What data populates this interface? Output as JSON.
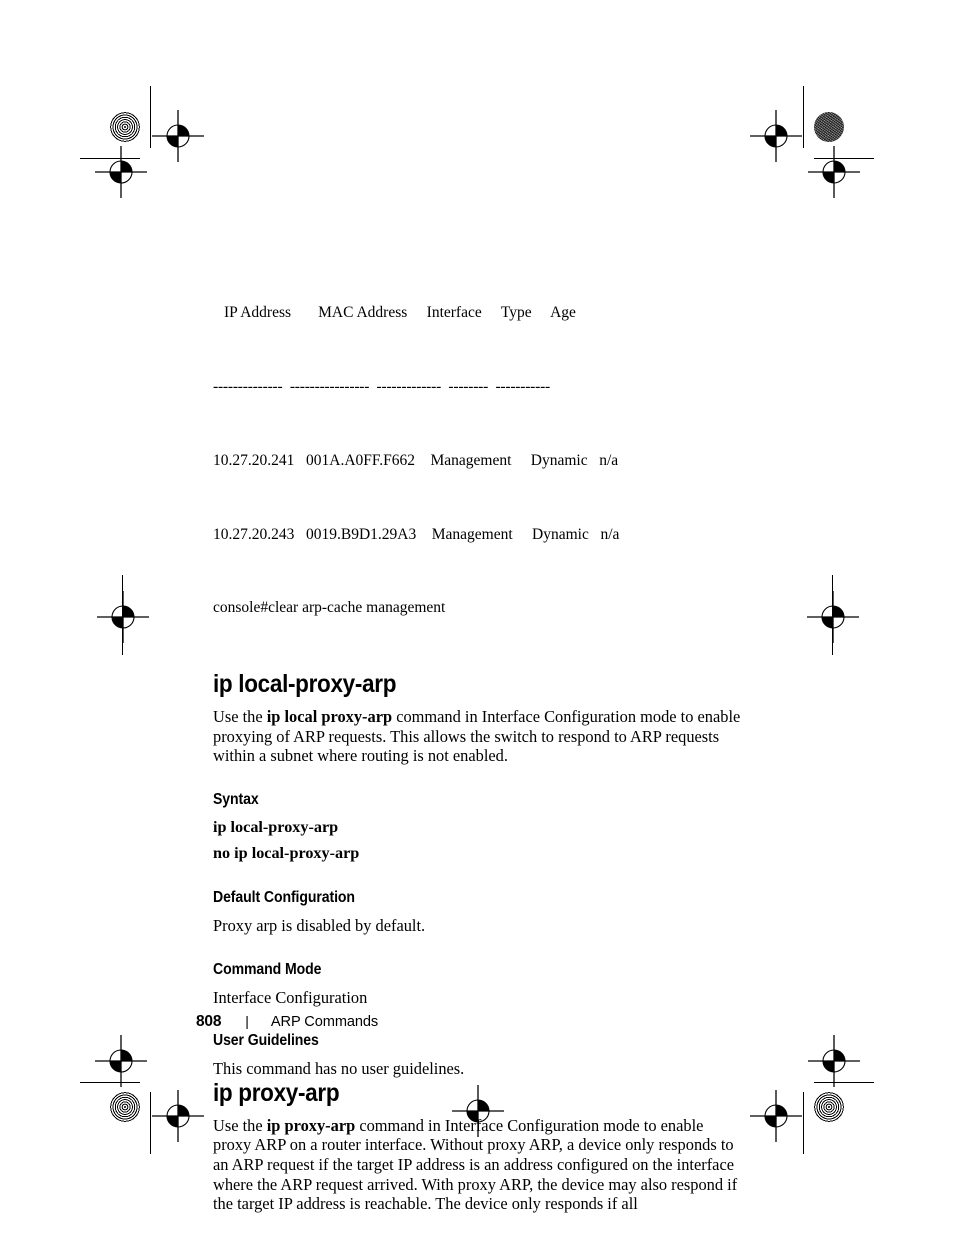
{
  "document": {
    "footer": {
      "page_number": "808",
      "separator": "|",
      "section": "ARP Commands"
    }
  },
  "cli_output": {
    "header": "IP Address       MAC Address     Interface     Type     Age",
    "rule": "--------------  ----------------  -------------  --------  -----------",
    "rows": [
      "10.27.20.241   001A.A0FF.F662    Management     Dynamic   n/a",
      "10.27.20.243   0019.B9D1.29A3    Management     Dynamic   n/a"
    ],
    "prompt_line": "console#clear arp-cache management"
  },
  "sections": [
    {
      "title": "ip local-proxy-arp",
      "intro_prefix": "Use the ",
      "intro_bold": "ip local proxy-arp",
      "intro_suffix": " command in Interface Configuration mode to enable proxying of ARP requests. This allows the switch to respond to ARP requests within a subnet where routing is not enabled.",
      "syntax_heading": "Syntax",
      "syntax_lines": [
        "ip local-proxy-arp",
        "no ip local-proxy-arp"
      ],
      "default_heading": "Default Configuration",
      "default_text": "Proxy arp is disabled by default.",
      "mode_heading": "Command Mode",
      "mode_text": "Interface Configuration",
      "guidelines_heading": "User Guidelines",
      "guidelines_text": "This command has no user guidelines."
    },
    {
      "title": "ip proxy-arp",
      "intro_prefix": "Use the ",
      "intro_bold": "ip proxy-arp",
      "intro_suffix": " command in Interface Configuration mode to enable proxy ARP on a router interface. Without proxy ARP, a device only responds to an ARP request if the target IP address is an address configured on the interface where the ARP request arrived. With proxy ARP, the device may also respond if the target IP address is reachable. The device only responds if all"
    }
  ]
}
